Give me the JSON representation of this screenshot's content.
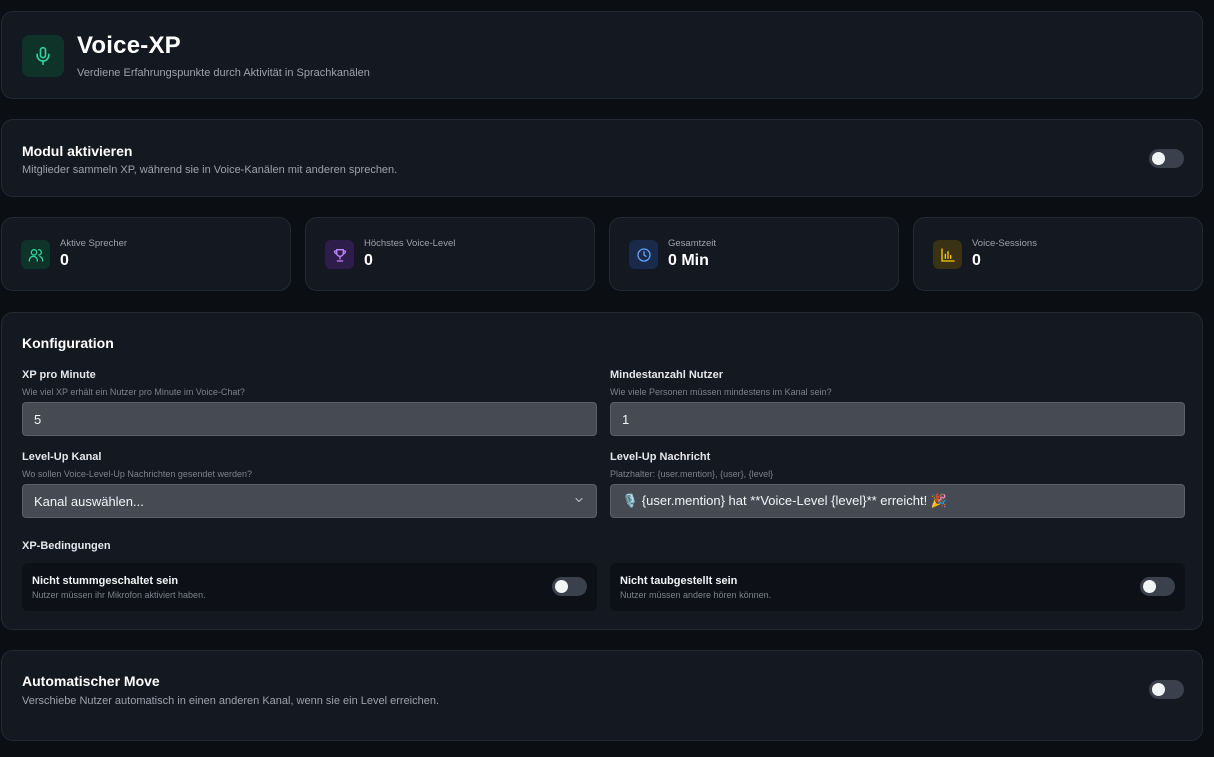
{
  "header": {
    "title": "Voice-XP",
    "subtitle": "Verdiene Erfahrungspunkte durch Aktivität in Sprachkanälen",
    "icon": "microphone-icon",
    "accent": "#34d399"
  },
  "module": {
    "title": "Modul aktivieren",
    "description": "Mitglieder sammeln XP, während sie in Voice-Kanälen mit anderen sprechen.",
    "enabled": false
  },
  "stats": [
    {
      "label": "Aktive Sprecher",
      "value": "0",
      "icon": "users-icon",
      "color": "#34d399",
      "bg": "#0e3329"
    },
    {
      "label": "Höchstes Voice-Level",
      "value": "0",
      "icon": "trophy-icon",
      "color": "#c084fc",
      "bg": "#2e1d4a"
    },
    {
      "label": "Gesamtzeit",
      "value": "0 Min",
      "icon": "clock-icon",
      "color": "#60a5fa",
      "bg": "#1a2a4a"
    },
    {
      "label": "Voice-Sessions",
      "value": "0",
      "icon": "bar-chart-icon",
      "color": "#facc15",
      "bg": "#3a3215"
    }
  ],
  "config": {
    "title": "Konfiguration",
    "xp_per_minute": {
      "label": "XP pro Minute",
      "hint": "Wie viel XP erhält ein Nutzer pro Minute im Voice-Chat?",
      "value": "5"
    },
    "min_users": {
      "label": "Mindestanzahl Nutzer",
      "hint": "Wie viele Personen müssen mindestens im Kanal sein?",
      "value": "1"
    },
    "levelup_channel": {
      "label": "Level-Up Kanal",
      "hint": "Wo sollen Voice-Level-Up Nachrichten gesendet werden?",
      "value": "Kanal auswählen..."
    },
    "levelup_message": {
      "label": "Level-Up Nachricht",
      "hint": "Platzhalter: {user.mention}, {user}, {level}",
      "value": "🎙️ {user.mention} hat **Voice-Level {level}** erreicht! 🎉"
    },
    "conditions_title": "XP-Bedingungen",
    "conditions": [
      {
        "title": "Nicht stummgeschaltet sein",
        "description": "Nutzer müssen ihr Mikrofon aktiviert haben.",
        "enabled": false
      },
      {
        "title": "Nicht taubgestellt sein",
        "description": "Nutzer müssen andere hören können.",
        "enabled": false
      }
    ]
  },
  "auto_move": {
    "title": "Automatischer Move",
    "description": "Verschiebe Nutzer automatisch in einen anderen Kanal, wenn sie ein Level erreichen.",
    "enabled": false
  }
}
